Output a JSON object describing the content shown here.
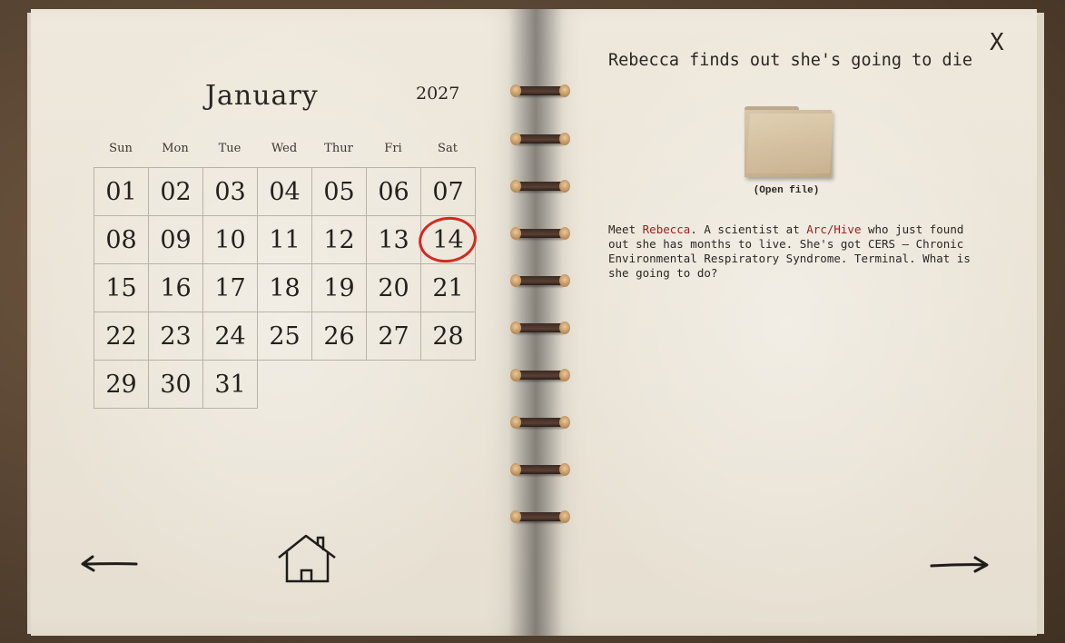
{
  "calendar": {
    "month": "January",
    "year": "2027",
    "weekdays": [
      "Sun",
      "Mon",
      "Tue",
      "Wed",
      "Thur",
      "Fri",
      "Sat"
    ],
    "days": [
      "01",
      "02",
      "03",
      "04",
      "05",
      "06",
      "07",
      "08",
      "09",
      "10",
      "11",
      "12",
      "13",
      "14",
      "15",
      "16",
      "17",
      "18",
      "19",
      "20",
      "21",
      "22",
      "23",
      "24",
      "25",
      "26",
      "27",
      "28",
      "29",
      "30",
      "31"
    ],
    "selected_day": "14"
  },
  "entry": {
    "title": "Rebecca finds out she's going to die",
    "folder_label": "(Open file)",
    "desc_1": "Meet ",
    "desc_name": "Rebecca",
    "desc_2": ". A scientist at ",
    "desc_org": "Arc/Hive",
    "desc_3": " who just found out she has months to live. She's got CERS – Chronic Environmental Respiratory Syndrome. Terminal. What is she going to do?"
  },
  "controls": {
    "close_label": "X"
  },
  "colors": {
    "highlight": "#a21d1d",
    "circle": "#d22a22"
  },
  "icons": {
    "prev": "left-arrow-icon",
    "next": "right-arrow-icon",
    "home": "home-icon",
    "folder": "folder-icon"
  }
}
